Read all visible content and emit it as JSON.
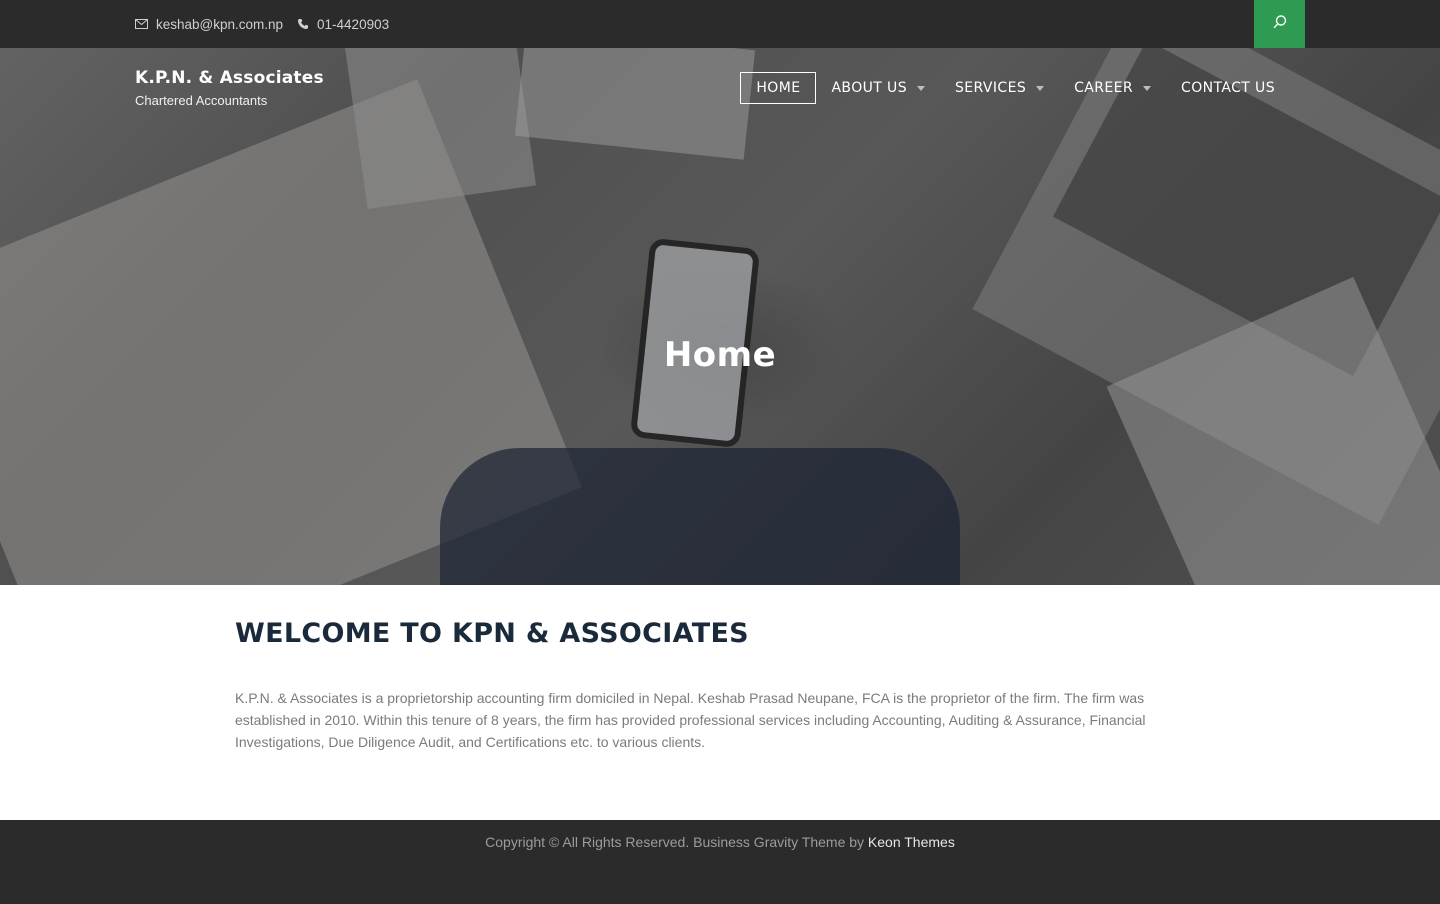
{
  "topbar": {
    "email": "keshab@kpn.com.np",
    "phone": "01-4420903",
    "email_icon": "envelope-icon",
    "phone_icon": "phone-icon",
    "search_icon": "search-icon",
    "search_color": "#2f9a52"
  },
  "brand": {
    "name": "K.P.N. & Associates",
    "tagline": "Chartered Accountants"
  },
  "nav": {
    "items": [
      {
        "label": "HOME",
        "active": true,
        "has_dropdown": false
      },
      {
        "label": "ABOUT US",
        "active": false,
        "has_dropdown": true
      },
      {
        "label": "SERVICES",
        "active": false,
        "has_dropdown": true
      },
      {
        "label": "CAREER",
        "active": false,
        "has_dropdown": true
      },
      {
        "label": "CONTACT US",
        "active": false,
        "has_dropdown": false
      }
    ]
  },
  "hero": {
    "title": "Home"
  },
  "main": {
    "heading": "WELCOME TO KPN & ASSOCIATES",
    "body": "K.P.N. & Associates is a proprietorship accounting firm domiciled in Nepal. Keshab Prasad Neupane, FCA is the proprietor of the firm. The firm was established in 2010. Within this tenure of 8 years, the firm has provided professional services including Accounting, Auditing & Assurance, Financial Investigations, Due Diligence Audit, and Certifications etc. to various clients."
  },
  "footer": {
    "copyright": "Copyright © All Rights Reserved. Business Gravity Theme by",
    "theme_link": "Keon Themes"
  }
}
